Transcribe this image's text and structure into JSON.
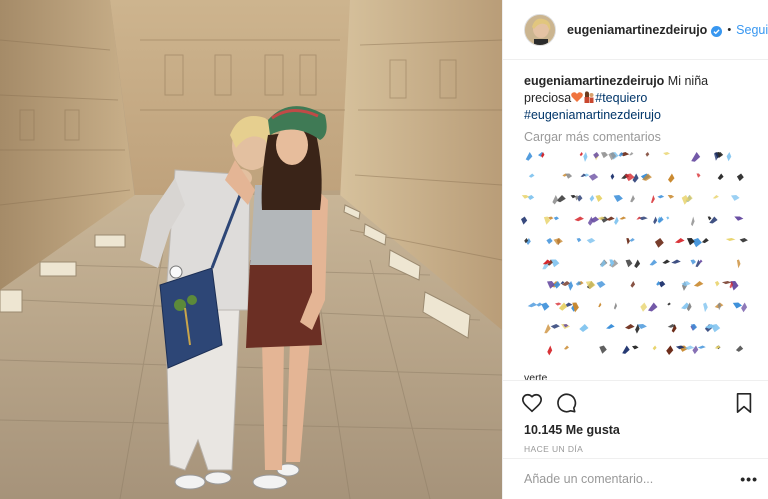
{
  "post": {
    "username": "eugeniamartinezdeirujo",
    "follow_label": "Seguir",
    "dot": "•",
    "caption": {
      "username": "eugeniamartinezdeirujo",
      "text": "Mi niña preciosa",
      "hashtag1": "#tequiero",
      "hashtag2": "#eugeniamartinezdeirujo"
    },
    "load_more": "Cargar más comentarios",
    "partial_comment": "verte",
    "likes": "10.145 Me gusta",
    "time": "HACE UN DÍA",
    "comment_placeholder": "Añade un comentario...",
    "more_label": "•••"
  },
  "icons": [
    "heart-icon",
    "comment-icon",
    "bookmark-icon",
    "verified-badge-icon",
    "more-options-icon"
  ],
  "colors": {
    "link": "#3897f0",
    "hashtag": "#003569",
    "muted": "#999999",
    "text": "#262626",
    "verified": "#3897f0"
  }
}
